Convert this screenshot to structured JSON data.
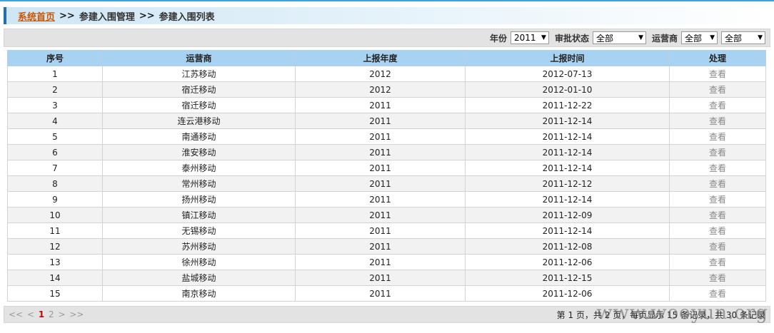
{
  "breadcrumb": {
    "home": "系统首页",
    "sep1": ">>",
    "level2": "参建入围管理",
    "sep2": ">>",
    "level3": "参建入围列表"
  },
  "filters": {
    "year_label": "年份",
    "year_value": "2011",
    "status_label": "审批状态",
    "status_value": "全部",
    "carrier_label": "运营商",
    "carrier_value": "全部",
    "other_value": "全部"
  },
  "table": {
    "headers": [
      "序号",
      "运营商",
      "上报年度",
      "上报时间",
      "处理"
    ],
    "rows": [
      {
        "no": "1",
        "carrier": "江苏移动",
        "year": "2012",
        "date": "2012-07-13",
        "action": "查看"
      },
      {
        "no": "2",
        "carrier": "宿迁移动",
        "year": "2012",
        "date": "2012-01-10",
        "action": "查看"
      },
      {
        "no": "3",
        "carrier": "宿迁移动",
        "year": "2011",
        "date": "2011-12-22",
        "action": "查看"
      },
      {
        "no": "4",
        "carrier": "连云港移动",
        "year": "2011",
        "date": "2011-12-14",
        "action": "查看"
      },
      {
        "no": "5",
        "carrier": "南通移动",
        "year": "2011",
        "date": "2011-12-14",
        "action": "查看"
      },
      {
        "no": "6",
        "carrier": "淮安移动",
        "year": "2011",
        "date": "2011-12-14",
        "action": "查看"
      },
      {
        "no": "7",
        "carrier": "泰州移动",
        "year": "2011",
        "date": "2011-12-14",
        "action": "查看"
      },
      {
        "no": "8",
        "carrier": "常州移动",
        "year": "2011",
        "date": "2011-12-12",
        "action": "查看"
      },
      {
        "no": "9",
        "carrier": "扬州移动",
        "year": "2011",
        "date": "2011-12-14",
        "action": "查看"
      },
      {
        "no": "10",
        "carrier": "镇江移动",
        "year": "2011",
        "date": "2011-12-09",
        "action": "查看"
      },
      {
        "no": "11",
        "carrier": "无锡移动",
        "year": "2011",
        "date": "2011-12-14",
        "action": "查看"
      },
      {
        "no": "12",
        "carrier": "苏州移动",
        "year": "2011",
        "date": "2011-12-08",
        "action": "查看"
      },
      {
        "no": "13",
        "carrier": "徐州移动",
        "year": "2011",
        "date": "2011-12-06",
        "action": "查看"
      },
      {
        "no": "14",
        "carrier": "盐城移动",
        "year": "2011",
        "date": "2011-12-15",
        "action": "查看"
      },
      {
        "no": "15",
        "carrier": "南京移动",
        "year": "2011",
        "date": "2011-12-06",
        "action": "查看"
      }
    ]
  },
  "pager": {
    "first": "<<",
    "prev": "<",
    "page1": "1",
    "page2": "2",
    "next": ">",
    "last": ">>",
    "info": "第 1 页，共 2 页，每页显示 15 条记录，共 30 条记录"
  },
  "watermark": "www.wooyun.org",
  "colors": {
    "header_bg": "#a8d2f2",
    "accent": "#1f6fb2",
    "home_link": "#cc5500",
    "current_page": "#cc0000"
  }
}
